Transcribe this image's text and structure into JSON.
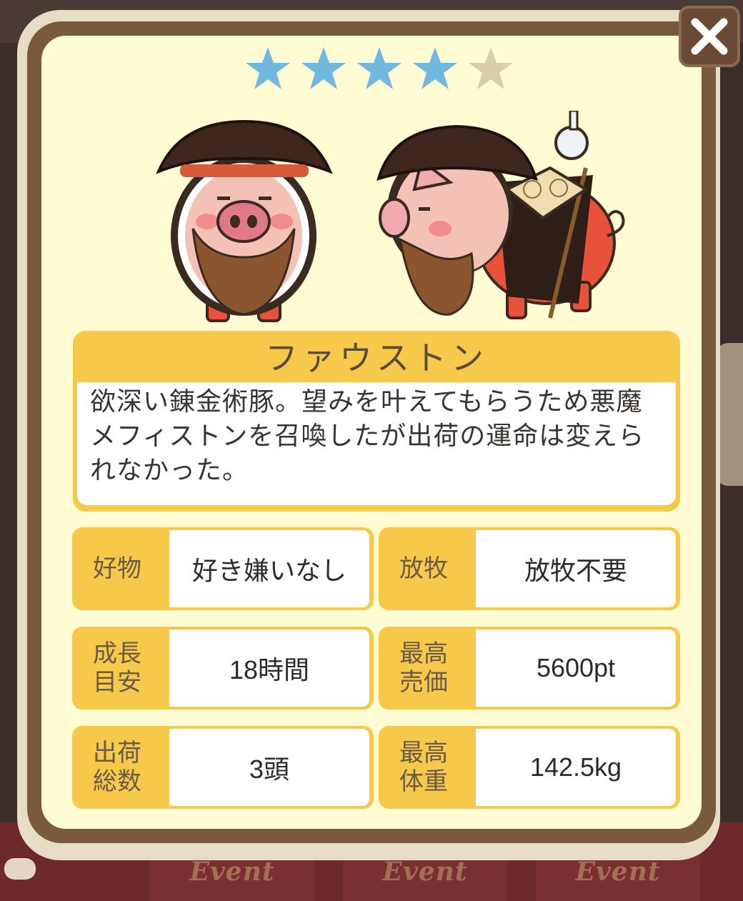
{
  "stars": {
    "rating": 4,
    "max": 5,
    "filled_color": "#6fb8de",
    "empty_color": "#d8cfa8"
  },
  "character": {
    "name": "ファウストン",
    "description": "欲深い錬金術豚。望みを叶えてもらうため悪魔メフィストンを召喚したが出荷の運命は変えられなかった。"
  },
  "stats": [
    {
      "label": "好物",
      "value": "好き嫌いなし"
    },
    {
      "label": "放牧",
      "value": "放牧不要"
    },
    {
      "label": "成長目安",
      "value": "18時間"
    },
    {
      "label": "最高売価",
      "value": "5600pt"
    },
    {
      "label": "出荷総数",
      "value": "3頭"
    },
    {
      "label": "最高体重",
      "value": "142.5kg"
    }
  ],
  "background_tabs": [
    "Event",
    "Event",
    "Event"
  ],
  "colors": {
    "accent": "#f6c94a",
    "panel": "#fffbd2",
    "frame": "#7a5a3c"
  }
}
